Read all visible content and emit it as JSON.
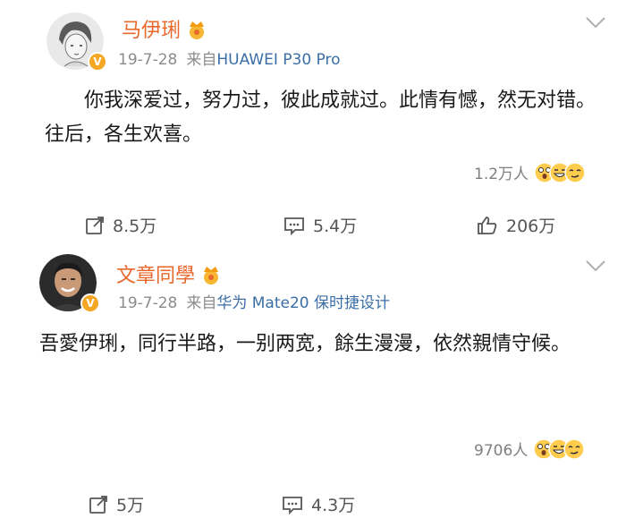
{
  "posts": [
    {
      "username": "马伊琍",
      "date": "19-7-28",
      "source_prefix": "来自",
      "source_device": "HUAWEI P30 Pro",
      "content": "你我深爱过，努力过，彼此成就过。此情有憾，然无对错。往后，各生欢喜。",
      "reaction_count": "1.2万人",
      "reposts": "8.5万",
      "comments": "5.4万",
      "likes": "206万",
      "avatar_icon": "sketch-portrait-avatar",
      "verified_color": "#f5a623"
    },
    {
      "username": "文章同學",
      "date": "19-7-28",
      "source_prefix": "来自",
      "source_device": "华为 Mate20 保时捷设计",
      "content": "吾愛伊琍，同行半路，一别两宽，餘生漫漫，依然親情守候。",
      "reaction_count": "9706人",
      "reposts": "5万",
      "comments": "4.3万",
      "avatar_icon": "photo-portrait-avatar",
      "verified_color": "#f5a623"
    }
  ],
  "colors": {
    "username": "#e8672b",
    "source_link": "#3a6ea5",
    "meta": "#8c8c8c"
  }
}
